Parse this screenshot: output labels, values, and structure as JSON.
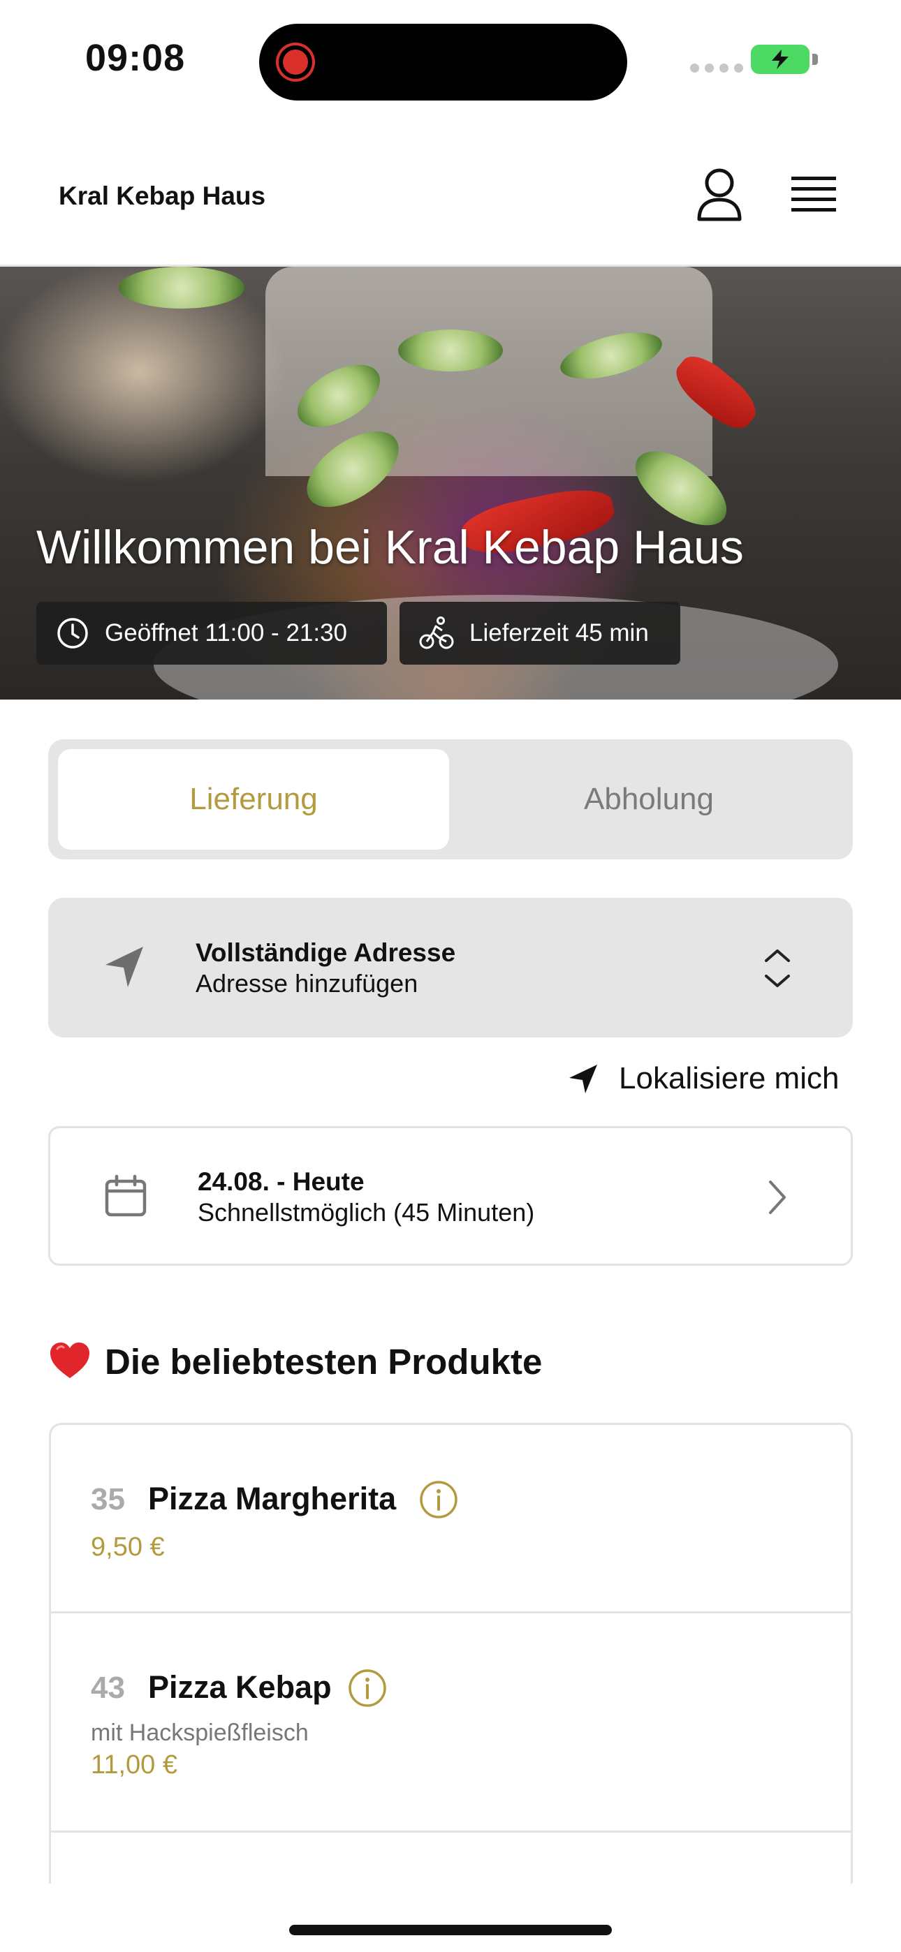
{
  "status_bar": {
    "time": "09:08"
  },
  "header": {
    "brand": "Kral Kebap Haus"
  },
  "hero": {
    "title": "Willkommen bei Kral Kebap Haus",
    "hours": "Geöffnet 11:00 - 21:30",
    "delivery_time": "Lieferzeit 45 min"
  },
  "order_mode": {
    "tabs": [
      {
        "label": "Lieferung",
        "active": true
      },
      {
        "label": "Abholung",
        "active": false
      }
    ]
  },
  "address": {
    "title": "Vollständige Adresse",
    "subtitle": "Adresse hinzufügen",
    "locate_label": "Lokalisiere mich"
  },
  "schedule": {
    "title": "24.08. - Heute",
    "subtitle": "Schnellstmöglich (45 Minuten)"
  },
  "popular": {
    "title": "Die beliebtesten Produkte",
    "items": [
      {
        "number": "35",
        "name": "Pizza Margherita",
        "description": "",
        "price": "9,50 €"
      },
      {
        "number": "43",
        "name": "Pizza Kebap",
        "description": "mit Hackspießfleisch",
        "price": "11,00 €"
      }
    ]
  },
  "colors": {
    "accent": "#b39a3e",
    "card_bg": "#e5e5e5",
    "badge_bg": "#1e1e1e"
  },
  "icons": [
    "user-icon",
    "menu-icon",
    "clock-icon",
    "bike-icon",
    "location-arrow-icon",
    "chevron-updown-icon",
    "calendar-icon",
    "chevron-right-icon",
    "heart-icon",
    "info-icon"
  ]
}
